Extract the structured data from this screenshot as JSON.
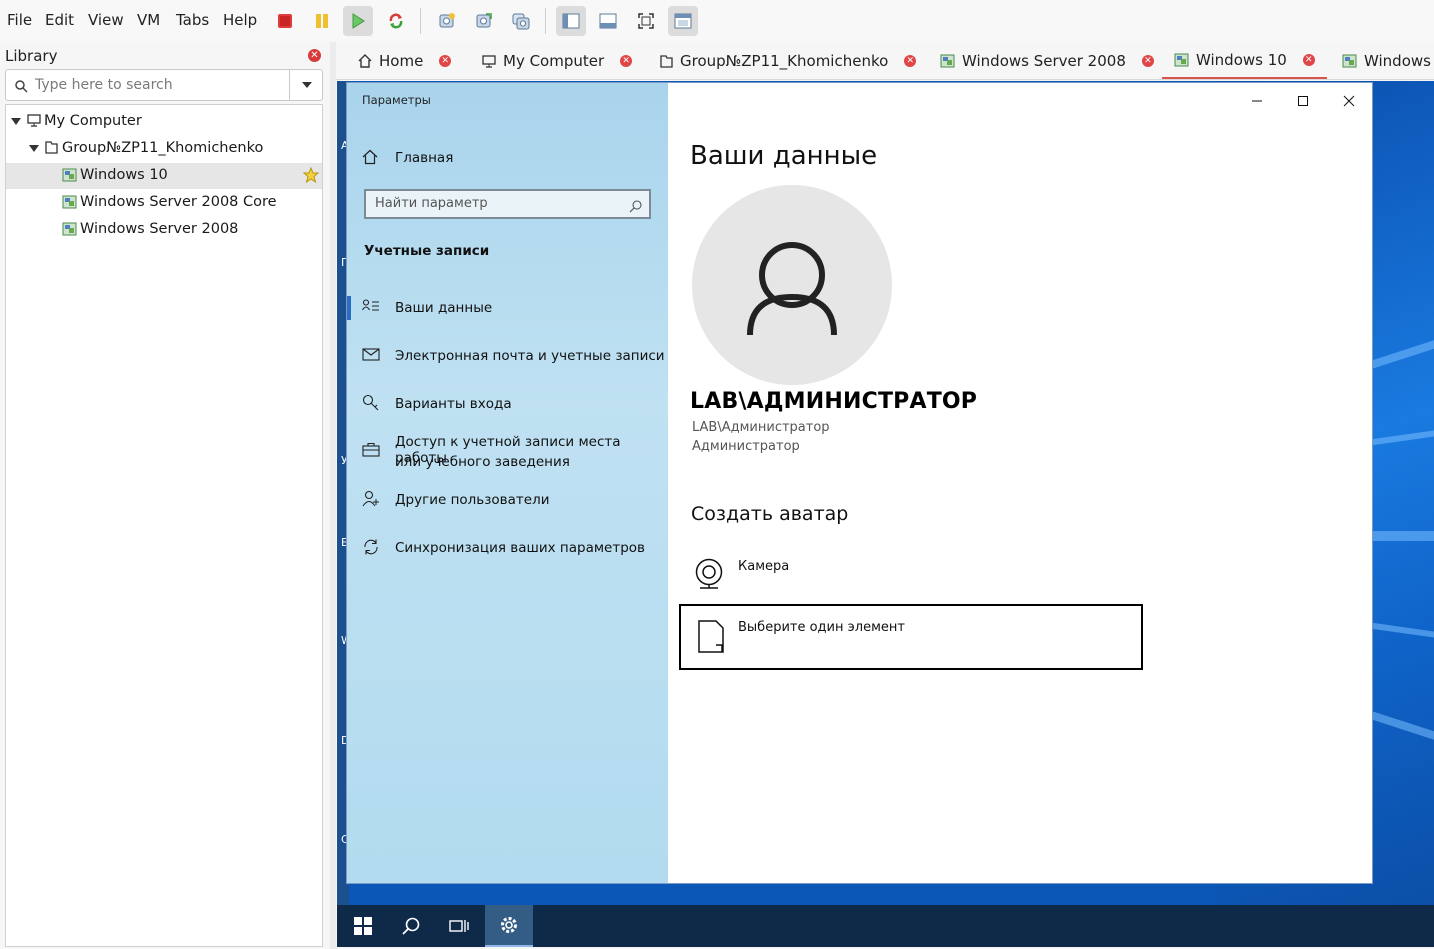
{
  "menu": {
    "file": "File",
    "edit": "Edit",
    "view": "View",
    "vm": "VM",
    "tabs": "Tabs",
    "help": "Help"
  },
  "toolbar": {
    "icons": [
      "stop-icon",
      "pause-icon",
      "play-icon",
      "restart-icon",
      "snapshot-icon",
      "snapshot-revert-icon",
      "snapshot-manager-icon",
      "library-view-icon",
      "thumbnail-bar-icon",
      "fullscreen-icon",
      "console-view-icon"
    ],
    "accent_red": "#d9534f",
    "play_green": "#53b145"
  },
  "library": {
    "title": "Library",
    "search_placeholder": "Type here to search",
    "tree": [
      {
        "label": "My Computer",
        "level": 0,
        "icon": "computer-icon"
      },
      {
        "label": "Group№ZP11_Khomichenko",
        "level": 1,
        "icon": "folder-icon"
      },
      {
        "label": "Windows 10",
        "level": 2,
        "icon": "vm-icon",
        "selected": true,
        "favorite": true
      },
      {
        "label": "Windows Server 2008 Core",
        "level": 2,
        "icon": "vm-icon"
      },
      {
        "label": "Windows Server 2008",
        "level": 2,
        "icon": "vm-icon"
      }
    ]
  },
  "tabs": [
    {
      "label": "Home",
      "icon": "home-icon"
    },
    {
      "label": "My Computer",
      "icon": "computer-icon"
    },
    {
      "label": "Group№ZP11_Khomichenko",
      "icon": "folder-icon"
    },
    {
      "label": "Windows Server 2008",
      "icon": "vm-icon"
    },
    {
      "label": "Windows 10",
      "icon": "vm-icon",
      "active": true
    },
    {
      "label": "Windows",
      "icon": "vm-icon"
    }
  ],
  "desktop_edge_letters": [
    "A",
    "Г",
    "У",
    "Е",
    "W",
    "D",
    "C"
  ],
  "settings": {
    "window_title": "Параметры",
    "home": "Главная",
    "search_placeholder": "Найти параметр",
    "section": "Учетные записи",
    "nav": [
      {
        "label": "Ваши данные",
        "icon": "user-info-icon",
        "selected": true
      },
      {
        "label": "Электронная почта и учетные записи",
        "icon": "mail-icon"
      },
      {
        "label": "Варианты входа",
        "icon": "key-icon"
      },
      {
        "label": "Доступ к учетной записи места работы",
        "label2": "или учебного заведения",
        "icon": "briefcase-icon"
      },
      {
        "label": "Другие пользователи",
        "icon": "add-user-icon"
      },
      {
        "label": "Синхронизация ваших параметров",
        "icon": "sync-icon"
      }
    ],
    "page_title": "Ваши данные",
    "user_name": "LAB\\АДМИНИСТРАТОР",
    "account": "LAB\\Администратор",
    "role": "Администратор",
    "create_avatar": "Создать аватар",
    "camera": "Камера",
    "choose": "Выберите один элемент",
    "accent": "#2b6cc4"
  }
}
